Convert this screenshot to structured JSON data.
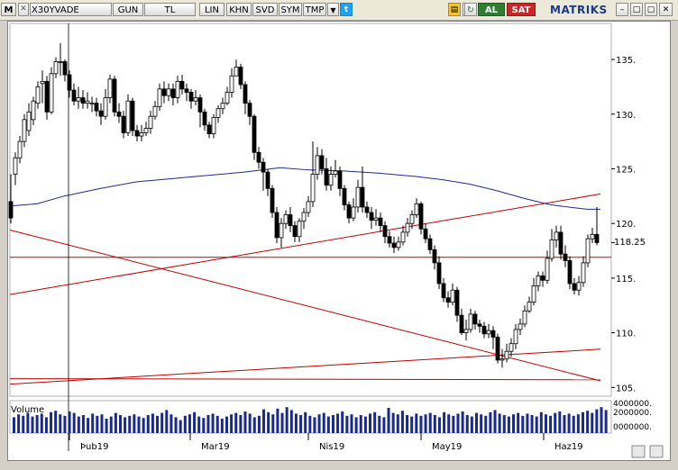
{
  "toolbar": {
    "logo_letter": "M",
    "symbol": "X30YVADE",
    "period": "GUN",
    "currency": "TL",
    "buttons": [
      "LIN",
      "KHN",
      "SVD",
      "SYM",
      "TMP"
    ],
    "al": "AL",
    "sat": "SAT",
    "brand": "MATRIKS",
    "colors": {
      "al_bg": "#2e7d32",
      "sat_bg": "#c62828",
      "brand": "#1a3a8a"
    }
  },
  "chart_data": {
    "type": "candlestick",
    "y_axis": {
      "ticks": [
        135,
        130,
        125,
        120,
        115,
        110,
        105
      ],
      "ylim": [
        104.2,
        138.3
      ]
    },
    "last_price_label": "118.25",
    "last_price": 118.25,
    "x_axis": {
      "labels": [
        "Þub19",
        "Mar19",
        "Nis19",
        "May19",
        "Haz19"
      ]
    },
    "volume_panel": {
      "label": "Volume",
      "ticks": [
        "4000000.",
        "2000000.",
        "0000000."
      ]
    },
    "horizontal_line": 116.9,
    "moving_average": [
      [
        0,
        121.6
      ],
      [
        30,
        121.8
      ],
      [
        60,
        122.5
      ],
      [
        100,
        123.2
      ],
      [
        140,
        123.8
      ],
      [
        180,
        124.1
      ],
      [
        220,
        124.4
      ],
      [
        260,
        124.7
      ],
      [
        300,
        125.1
      ],
      [
        330,
        124.9
      ],
      [
        370,
        124.8
      ],
      [
        410,
        124.6
      ],
      [
        450,
        124.3
      ],
      [
        480,
        124.0
      ],
      [
        510,
        123.6
      ],
      [
        540,
        123.0
      ],
      [
        570,
        122.3
      ],
      [
        600,
        121.7
      ],
      [
        640,
        121.3
      ],
      [
        655,
        121.3
      ]
    ],
    "trend_lines": [
      [
        [
          0,
          119.4
        ],
        [
          655,
          105.6
        ]
      ],
      [
        [
          0,
          113.5
        ],
        [
          655,
          122.7
        ]
      ],
      [
        [
          0,
          105.3
        ],
        [
          655,
          108.5
        ]
      ],
      [
        [
          0,
          105.8
        ],
        [
          655,
          105.7
        ]
      ]
    ],
    "candles": [
      [
        1,
        122,
        120.5,
        124.5,
        120
      ],
      [
        6,
        124.5,
        126,
        126.5,
        123.5
      ],
      [
        11,
        126,
        127.5,
        128,
        125.5
      ],
      [
        16,
        127.5,
        129.5,
        130,
        127
      ],
      [
        21,
        128.5,
        130.2,
        131,
        128
      ],
      [
        26,
        129.5,
        131.2,
        131.6,
        129
      ],
      [
        31,
        131,
        132.5,
        133,
        130.5
      ],
      [
        36,
        132.8,
        133,
        134,
        131
      ],
      [
        41,
        133,
        130.2,
        133.5,
        129.5
      ],
      [
        46,
        130.2,
        133.7,
        134.3,
        130
      ],
      [
        51,
        133.7,
        134.8,
        135.2,
        133.3
      ],
      [
        56,
        134.8,
        134.8,
        136.5,
        133.5
      ],
      [
        61,
        134.8,
        133.6,
        135,
        133
      ],
      [
        66,
        133.6,
        132.2,
        134,
        131.5
      ],
      [
        71,
        132.2,
        131.2,
        132.8,
        130.8
      ],
      [
        76,
        131.2,
        131.5,
        132.5,
        130.5
      ],
      [
        81,
        131.5,
        131,
        132.2,
        130.5
      ],
      [
        86,
        131,
        131.2,
        132,
        130.5
      ],
      [
        91,
        131,
        131,
        131.6,
        130.2
      ],
      [
        96,
        131,
        130.3,
        131.5,
        129.8
      ],
      [
        101,
        130.3,
        129.8,
        131,
        129
      ],
      [
        106,
        129.8,
        131.5,
        132.3,
        129.5
      ],
      [
        111,
        131.5,
        133.2,
        133.6,
        131
      ],
      [
        116,
        133.2,
        130.2,
        133.5,
        129.8
      ],
      [
        121,
        130.2,
        129.8,
        131,
        129.2
      ],
      [
        126,
        129.8,
        128.3,
        130.3,
        127.8
      ],
      [
        131,
        128.3,
        131.2,
        131.8,
        128
      ],
      [
        136,
        131.2,
        128.5,
        131.5,
        128
      ],
      [
        141,
        128.5,
        128,
        129,
        127.5
      ],
      [
        146,
        128,
        128.3,
        129,
        127.5
      ],
      [
        151,
        128.3,
        128.7,
        129.3,
        128
      ],
      [
        156,
        128.7,
        129.8,
        130.3,
        128.2
      ],
      [
        161,
        129.8,
        130.7,
        131.2,
        129.5
      ],
      [
        166,
        130.7,
        132.3,
        132.8,
        130.3
      ],
      [
        171,
        132.3,
        131.7,
        133,
        131
      ],
      [
        176,
        131.7,
        132.3,
        132.8,
        131.2
      ],
      [
        181,
        132.3,
        131.5,
        132.8,
        130.8
      ],
      [
        186,
        131.5,
        133,
        133.5,
        131
      ],
      [
        191,
        133,
        132.3,
        133.6,
        131.8
      ],
      [
        196,
        132.3,
        132,
        132.8,
        131.2
      ],
      [
        201,
        132,
        131.2,
        132.3,
        130.5
      ],
      [
        206,
        131.2,
        131.5,
        132.2,
        130.8
      ],
      [
        211,
        131.5,
        130.2,
        131.8,
        128.8
      ],
      [
        216,
        130.2,
        129,
        130.5,
        128.5
      ],
      [
        221,
        129,
        128.2,
        129.3,
        127.8
      ],
      [
        226,
        128.2,
        129.7,
        130,
        127.8
      ],
      [
        231,
        129.7,
        130.5,
        130.8,
        129.2
      ],
      [
        236,
        130.5,
        131,
        131.5,
        130
      ],
      [
        241,
        131,
        132,
        132.5,
        130.8
      ],
      [
        246,
        132,
        133.5,
        134.2,
        131.5
      ],
      [
        251,
        133.5,
        134.3,
        135,
        133.5
      ],
      [
        256,
        134.3,
        132.7,
        134.6,
        132.3
      ],
      [
        261,
        132.7,
        131,
        133,
        130
      ],
      [
        266,
        131,
        129.8,
        131.3,
        129
      ],
      [
        271,
        129.8,
        126.5,
        130,
        125.8
      ],
      [
        276,
        126.5,
        125.6,
        127,
        125
      ],
      [
        281,
        125.6,
        124.7,
        126,
        123
      ],
      [
        286,
        124.7,
        123.2,
        125,
        122.5
      ],
      [
        291,
        123.2,
        121,
        123.5,
        120.5
      ],
      [
        296,
        121,
        118.7,
        121.5,
        118.2
      ],
      [
        301,
        118.7,
        120,
        120.5,
        117.8
      ],
      [
        306,
        120,
        120.8,
        121.2,
        119.5
      ],
      [
        311,
        120.8,
        119.8,
        121.5,
        119.2
      ],
      [
        316,
        119.8,
        118.8,
        120.2,
        118.3
      ],
      [
        321,
        118.8,
        120.2,
        120.5,
        118.3
      ],
      [
        326,
        120.2,
        121,
        121.4,
        119.5
      ],
      [
        331,
        121,
        122,
        122.5,
        120.6
      ],
      [
        336,
        122,
        124.5,
        127.5,
        121.5
      ],
      [
        341,
        124.5,
        126.2,
        127,
        124
      ],
      [
        346,
        126.2,
        125,
        126.8,
        124.5
      ],
      [
        351,
        125,
        123.5,
        126,
        123
      ],
      [
        356,
        123.5,
        124.5,
        125.2,
        123
      ],
      [
        361,
        124.5,
        124.8,
        125.8,
        124.2
      ],
      [
        366,
        124.8,
        123.2,
        125.2,
        122.5
      ],
      [
        371,
        123.2,
        121.7,
        123.5,
        121.2
      ],
      [
        376,
        121.7,
        120.5,
        122,
        120
      ],
      [
        381,
        120.5,
        121.5,
        122.3,
        120.2
      ],
      [
        386,
        121.5,
        123.3,
        124,
        121
      ],
      [
        391,
        123.3,
        121.5,
        125.2,
        121
      ],
      [
        396,
        121.5,
        121,
        122,
        120.5
      ],
      [
        401,
        121,
        120.3,
        121.5,
        119.5
      ],
      [
        406,
        120.3,
        120.5,
        121.3,
        119.8
      ],
      [
        411,
        120.5,
        119.8,
        121,
        119.2
      ],
      [
        416,
        119.8,
        118.8,
        120.2,
        118.2
      ],
      [
        421,
        118.8,
        118.2,
        119.3,
        117.8
      ],
      [
        426,
        118.2,
        117.8,
        118.8,
        117.3
      ],
      [
        431,
        117.8,
        118.3,
        118.8,
        117.5
      ],
      [
        436,
        118.3,
        119.2,
        119.8,
        118
      ],
      [
        441,
        119.2,
        120,
        120.5,
        118.8
      ],
      [
        446,
        120,
        120.8,
        121.2,
        119.5
      ],
      [
        451,
        120.8,
        121.8,
        122.3,
        120.5
      ],
      [
        456,
        121.8,
        119.5,
        122,
        119
      ],
      [
        461,
        119.5,
        118.6,
        120,
        118.2
      ],
      [
        466,
        118.6,
        117.6,
        119,
        117.2
      ],
      [
        471,
        117.6,
        116.4,
        118,
        115.8
      ],
      [
        476,
        116.4,
        114.5,
        117,
        114
      ],
      [
        481,
        114.5,
        113.2,
        115,
        112.8
      ],
      [
        486,
        113.2,
        112.8,
        113.8,
        112.3
      ],
      [
        491,
        112.8,
        113.9,
        114.5,
        112.5
      ],
      [
        496,
        113.9,
        111.6,
        114.2,
        111
      ],
      [
        501,
        111.6,
        110,
        112.2,
        109.8
      ],
      [
        506,
        110,
        110.3,
        111.2,
        109.3
      ],
      [
        511,
        110.3,
        111.7,
        112.2,
        110
      ],
      [
        516,
        111.7,
        110.8,
        112,
        110.3
      ],
      [
        521,
        110.8,
        110.6,
        111.2,
        110
      ],
      [
        526,
        110.6,
        109.9,
        111,
        109.5
      ],
      [
        531,
        109.9,
        110.2,
        110.8,
        109.5
      ],
      [
        536,
        110.2,
        109.6,
        110.6,
        108.5
      ],
      [
        541,
        109.6,
        107.5,
        109.9,
        107.2
      ],
      [
        546,
        107.5,
        107.6,
        108.5,
        106.8
      ],
      [
        551,
        107.6,
        108.3,
        109,
        107.3
      ],
      [
        556,
        108.3,
        109,
        109.5,
        107.8
      ],
      [
        561,
        109,
        110.3,
        110.8,
        108.5
      ],
      [
        566,
        110.3,
        110.8,
        111.3,
        109.8
      ],
      [
        571,
        110.8,
        112,
        112.5,
        110.5
      ],
      [
        576,
        112,
        112.8,
        113.3,
        111.8
      ],
      [
        581,
        112.8,
        114.3,
        115,
        112.5
      ],
      [
        586,
        114.3,
        115.2,
        115.6,
        113.8
      ],
      [
        591,
        115.2,
        114.8,
        115.6,
        114.2
      ],
      [
        596,
        114.8,
        116.8,
        117.5,
        114.5
      ],
      [
        601,
        116.8,
        118.5,
        119.5,
        116.5
      ],
      [
        606,
        118.5,
        119.2,
        119.8,
        117.8
      ],
      [
        611,
        119.2,
        117.2,
        119.8,
        116.7
      ],
      [
        616,
        117.2,
        116.6,
        118,
        116
      ],
      [
        621,
        116.6,
        114.5,
        117,
        114
      ],
      [
        626,
        114.5,
        113.9,
        115,
        113.5
      ],
      [
        631,
        113.9,
        114.6,
        115.2,
        113.4
      ],
      [
        636,
        114.6,
        116.4,
        117,
        114.2
      ],
      [
        641,
        116.4,
        118.6,
        119,
        116
      ],
      [
        646,
        118.6,
        119,
        119.6,
        118.2
      ],
      [
        651,
        119,
        118.25,
        121.5,
        118
      ]
    ],
    "volumes": [
      2.2,
      2.6,
      2.4,
      2.8,
      2.3,
      2.5,
      2.7,
      2.2,
      2.9,
      3.1,
      2.6,
      2.4,
      3.0,
      2.8,
      2.3,
      2.5,
      2.1,
      2.7,
      2.4,
      2.6,
      2.0,
      2.3,
      2.8,
      2.5,
      2.2,
      2.4,
      2.6,
      2.3,
      2.1,
      2.5,
      2.7,
      2.4,
      2.8,
      3.2,
      2.6,
      2.2,
      1.8,
      2.4,
      2.6,
      2.9,
      2.3,
      2.1,
      2.5,
      2.7,
      2.4,
      2.0,
      2.3,
      2.6,
      2.8,
      2.5,
      3.0,
      2.7,
      2.2,
      2.4,
      3.3,
      2.9,
      2.6,
      3.4,
      2.8,
      3.6,
      3.2,
      2.7,
      2.5,
      2.9,
      2.4,
      2.2,
      2.6,
      2.8,
      2.3,
      2.5,
      2.7,
      3.0,
      2.4,
      2.6,
      2.2,
      2.5,
      2.3,
      2.7,
      2.9,
      2.4,
      2.2,
      3.5,
      2.8,
      2.6,
      3.1,
      2.5,
      2.3,
      2.7,
      2.4,
      2.6,
      2.8,
      2.5,
      2.2,
      2.9,
      2.6,
      2.4,
      2.7,
      3.0,
      2.5,
      2.3,
      2.8,
      2.6,
      2.4,
      2.9,
      3.2,
      2.7,
      2.5,
      2.3,
      2.6,
      2.8,
      2.4,
      2.7,
      2.5,
      2.3,
      2.9,
      2.6,
      2.4,
      2.8,
      3.0,
      2.5,
      2.7,
      2.4,
      2.6,
      2.9,
      3.1,
      2.8,
      3.3,
      3.6,
      3.2
    ]
  }
}
